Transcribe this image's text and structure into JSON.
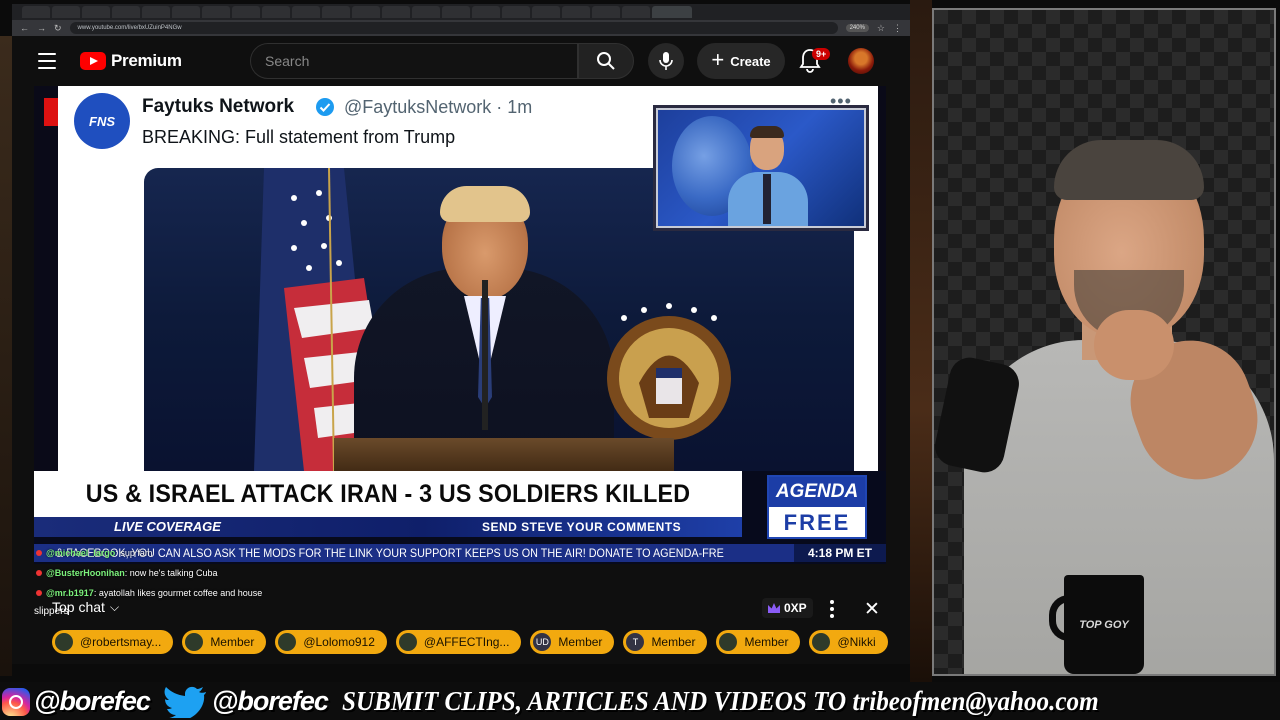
{
  "browser": {
    "url": "www.youtube.com/live/bxUZuinP4NGw",
    "zoom": "240%"
  },
  "header": {
    "logo_text": "Premium",
    "search_placeholder": "Search",
    "create_label": "Create",
    "notification_count": "9+",
    "icons": [
      "menu-icon",
      "search-icon",
      "mic-icon",
      "plus-icon",
      "bell-icon"
    ]
  },
  "video": {
    "tweet": {
      "name": "Faytuks Network",
      "handle_time": "@FaytuksNetwork · 1m",
      "text": "BREAKING: Full statement from Trump",
      "avatar_text": "FNS"
    },
    "lower_third": {
      "headline": "US & ISRAEL ATTACK IRAN - 3 US SOLDIERS KILLED",
      "live_coverage": "LIVE COVERAGE",
      "send_comments": "SEND STEVE YOUR COMMENTS",
      "logo_top": "AGENDA",
      "logo_bottom": "FREE",
      "ticker": "& FACEBOOK, YOU CAN ALSO ASK THE MODS FOR THE LINK    YOUR SUPPORT KEEPS US ON THE AIR! DONATE TO AGENDA-FRE",
      "time": "4:18 PM ET"
    },
    "overlay_chat": [
      {
        "user": "@michael_largo",
        "text": ": sup fam"
      },
      {
        "user": "@BusterHoonihan",
        "text": ": now he's talking Cuba"
      },
      {
        "user": "@mr.b1917",
        "text": ": ayatollah likes gourmet coffee and house"
      }
    ],
    "overlay_chat_wrap": "slippers"
  },
  "chat": {
    "mode_label": "Top chat",
    "xp": "0XP",
    "chips": [
      {
        "label": "@robertsmay...",
        "avatar": ""
      },
      {
        "label": "Member",
        "avatar": ""
      },
      {
        "label": "@Lolomo912",
        "avatar": ""
      },
      {
        "label": "@AFFECTIng...",
        "avatar": ""
      },
      {
        "label": "Member",
        "avatar": "UD"
      },
      {
        "label": "Member",
        "avatar": "T"
      },
      {
        "label": "Member",
        "avatar": ""
      },
      {
        "label": "@Nikki",
        "avatar": ""
      }
    ]
  },
  "webcam": {
    "mug_text": "TOP GOY"
  },
  "banner": {
    "instagram_handle": "@borefec",
    "twitter_handle": "@borefec",
    "submit_text": "SUBMIT CLIPS, ARTICLES AND VIDEOS TO tribeofmen@yahoo.com"
  },
  "colors": {
    "youtube_red": "#ff0000",
    "chip_gold": "#f2a90f",
    "agenda_blue": "#1c3da6"
  }
}
